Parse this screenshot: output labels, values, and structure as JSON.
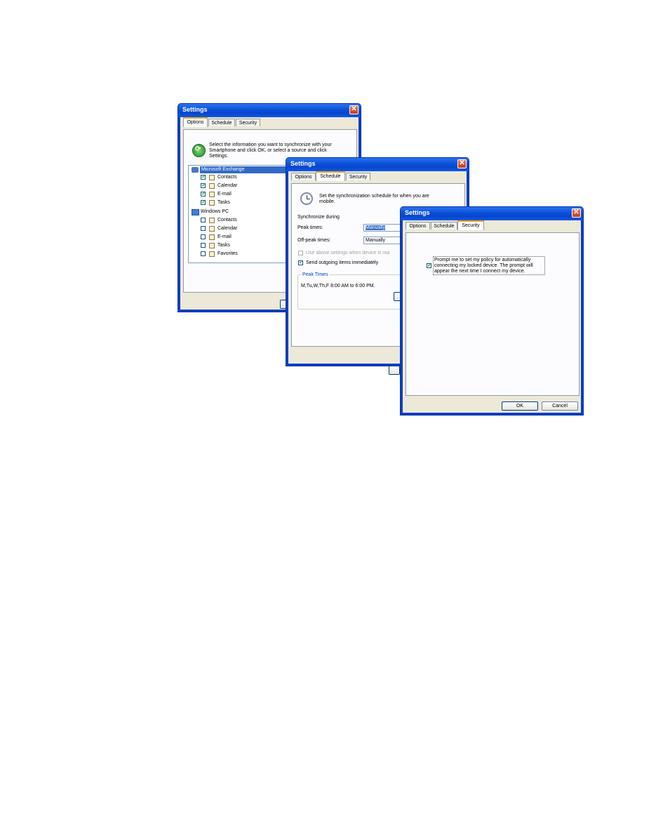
{
  "win1": {
    "title": "Settings",
    "tabs": [
      "Options",
      "Schedule",
      "Security"
    ],
    "intro": [
      "Select the information you want to synchronize with your",
      "Smartphone and click OK, or select a source and click",
      "Settings."
    ],
    "tree": {
      "exchange_label": "Microsoft Exchange",
      "exchange_items": [
        {
          "label": "Contacts",
          "checked": true,
          "icon": "contacts-icon"
        },
        {
          "label": "Calendar",
          "checked": true,
          "icon": "calendar-icon"
        },
        {
          "label": "E-mail",
          "checked": true,
          "icon": "email-icon"
        },
        {
          "label": "Tasks",
          "checked": true,
          "icon": "tasks-icon"
        }
      ],
      "pc_label": "Windows PC",
      "pc_items": [
        {
          "label": "Contacts",
          "checked": false,
          "icon": "contacts-icon"
        },
        {
          "label": "Calendar",
          "checked": false,
          "icon": "calendar-icon"
        },
        {
          "label": "E-mail",
          "checked": false,
          "icon": "email-icon"
        },
        {
          "label": "Tasks",
          "checked": false,
          "icon": "tasks-icon"
        },
        {
          "label": "Favorites",
          "checked": false,
          "icon": "favorites-icon"
        }
      ]
    }
  },
  "win2": {
    "title": "Settings",
    "tabs": [
      "Options",
      "Schedule",
      "Security"
    ],
    "intro": [
      "Set the synchronization schedule for when you are",
      "mobile."
    ],
    "sync_during": "Synchronize during",
    "peak_label": "Peak times:",
    "peak_value": "Manually",
    "offpeak_label": "Off-peak times:",
    "offpeak_value": "Manually",
    "roaming_label": "Use above settings when device is roa",
    "send_label": "Send outgoing items immediately",
    "peak_group": "Peak Times",
    "peak_desc": "M,Tu,W,Th,F 8:00 AM to 6:00 PM."
  },
  "win3": {
    "title": "Settings",
    "tabs": [
      "Options",
      "Schedule",
      "Security"
    ],
    "prompt_lines": [
      "Prompt me to set my policy for automatically",
      "connecting my locked device. The prompt will",
      "appear the next time I connect my device."
    ],
    "ok": "OK",
    "cancel": "Cancel"
  }
}
